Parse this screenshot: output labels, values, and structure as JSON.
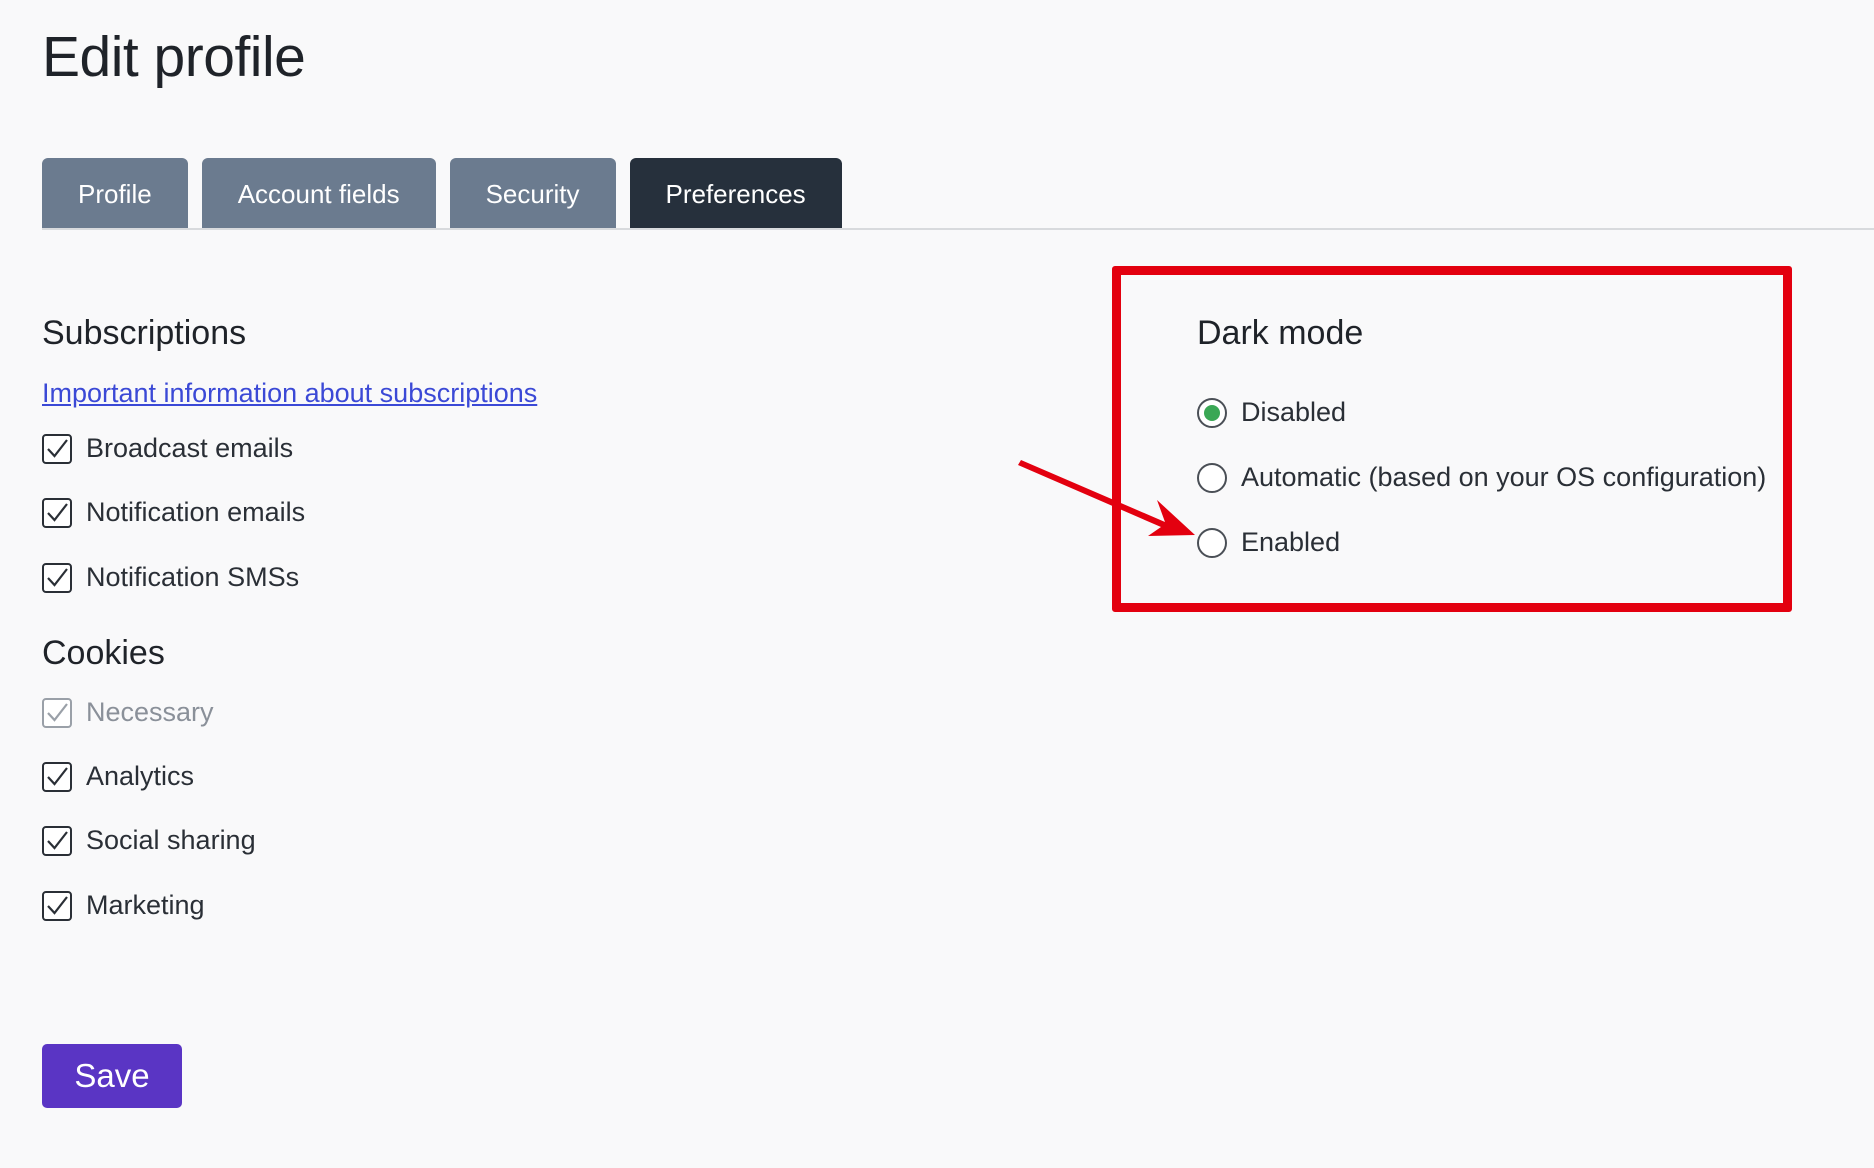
{
  "page": {
    "title": "Edit profile"
  },
  "tabs": [
    {
      "label": "Profile",
      "active": false
    },
    {
      "label": "Account fields",
      "active": false
    },
    {
      "label": "Security",
      "active": false
    },
    {
      "label": "Preferences",
      "active": true
    }
  ],
  "subscriptions": {
    "heading": "Subscriptions",
    "info_link": "Important information about subscriptions",
    "items": [
      {
        "label": "Broadcast emails",
        "checked": true,
        "disabled": false
      },
      {
        "label": "Notification emails",
        "checked": true,
        "disabled": false
      },
      {
        "label": "Notification SMSs",
        "checked": true,
        "disabled": false
      }
    ]
  },
  "cookies": {
    "heading": "Cookies",
    "items": [
      {
        "label": "Necessary",
        "checked": true,
        "disabled": true
      },
      {
        "label": "Analytics",
        "checked": true,
        "disabled": false
      },
      {
        "label": "Social sharing",
        "checked": true,
        "disabled": false
      },
      {
        "label": "Marketing",
        "checked": true,
        "disabled": false
      }
    ]
  },
  "dark_mode": {
    "heading": "Dark mode",
    "options": [
      {
        "label": "Disabled",
        "selected": true
      },
      {
        "label": "Automatic (based on your OS configuration)",
        "selected": false
      },
      {
        "label": "Enabled",
        "selected": false
      }
    ]
  },
  "actions": {
    "save_label": "Save"
  },
  "colors": {
    "accent": "#5a35c4",
    "tab_inactive": "#6b7b8f",
    "tab_active": "#26303c",
    "link": "#3b49d6",
    "radio_selected": "#3aa755",
    "annotation": "#e3000f"
  }
}
